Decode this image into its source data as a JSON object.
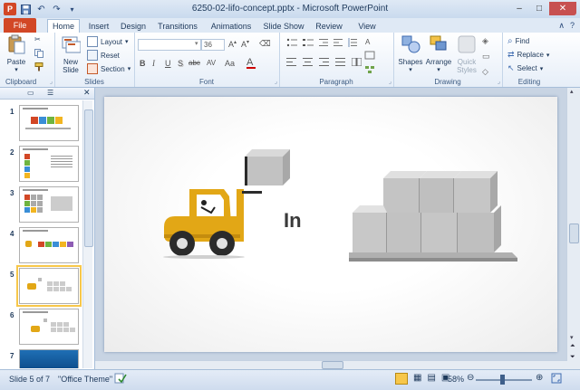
{
  "window": {
    "title": "6250-02-lifo-concept.pptx - Microsoft PowerPoint"
  },
  "qat": {
    "logo": "P"
  },
  "tabs": {
    "file": "File",
    "items": [
      "Home",
      "Insert",
      "Design",
      "Transitions",
      "Animations",
      "Slide Show",
      "Review",
      "View"
    ],
    "active": "Home"
  },
  "ribbon": {
    "clipboard": {
      "label": "Clipboard",
      "paste": "Paste"
    },
    "slides": {
      "label": "Slides",
      "new_slide_line1": "New",
      "new_slide_line2": "Slide",
      "layout": "Layout",
      "reset": "Reset",
      "section": "Section"
    },
    "font": {
      "label": "Font",
      "font_name": "",
      "font_size": "36",
      "bold": "B",
      "italic": "I",
      "underline": "U",
      "shadow": "S",
      "strike": "abc",
      "spacing": "AV",
      "case": "Aa"
    },
    "paragraph": {
      "label": "Paragraph"
    },
    "drawing": {
      "label": "Drawing",
      "shapes": "Shapes",
      "arrange": "Arrange",
      "quick_styles_line1": "Quick",
      "quick_styles_line2": "Styles"
    },
    "editing": {
      "label": "Editing",
      "find": "Find",
      "replace": "Replace",
      "select": "Select"
    }
  },
  "thumbnails": {
    "slides": [
      {
        "num": "1",
        "label": ""
      },
      {
        "num": "2",
        "label": ""
      },
      {
        "num": "3",
        "label": ""
      },
      {
        "num": "4",
        "label": ""
      },
      {
        "num": "5",
        "label": ""
      },
      {
        "num": "6",
        "label": ""
      },
      {
        "num": "7",
        "label": ""
      }
    ],
    "selected": 5
  },
  "slide": {
    "text": "In"
  },
  "status": {
    "slide_info": "Slide 5 of 7",
    "theme": "\"Office Theme\"",
    "zoom": "58%",
    "zoom_fraction": 0.58
  },
  "colors": {
    "accent": "#d24726",
    "forklift_yellow": "#e2a716",
    "ribbon_blue": "#1e395b",
    "selected_thumb": "#f7c74a"
  }
}
